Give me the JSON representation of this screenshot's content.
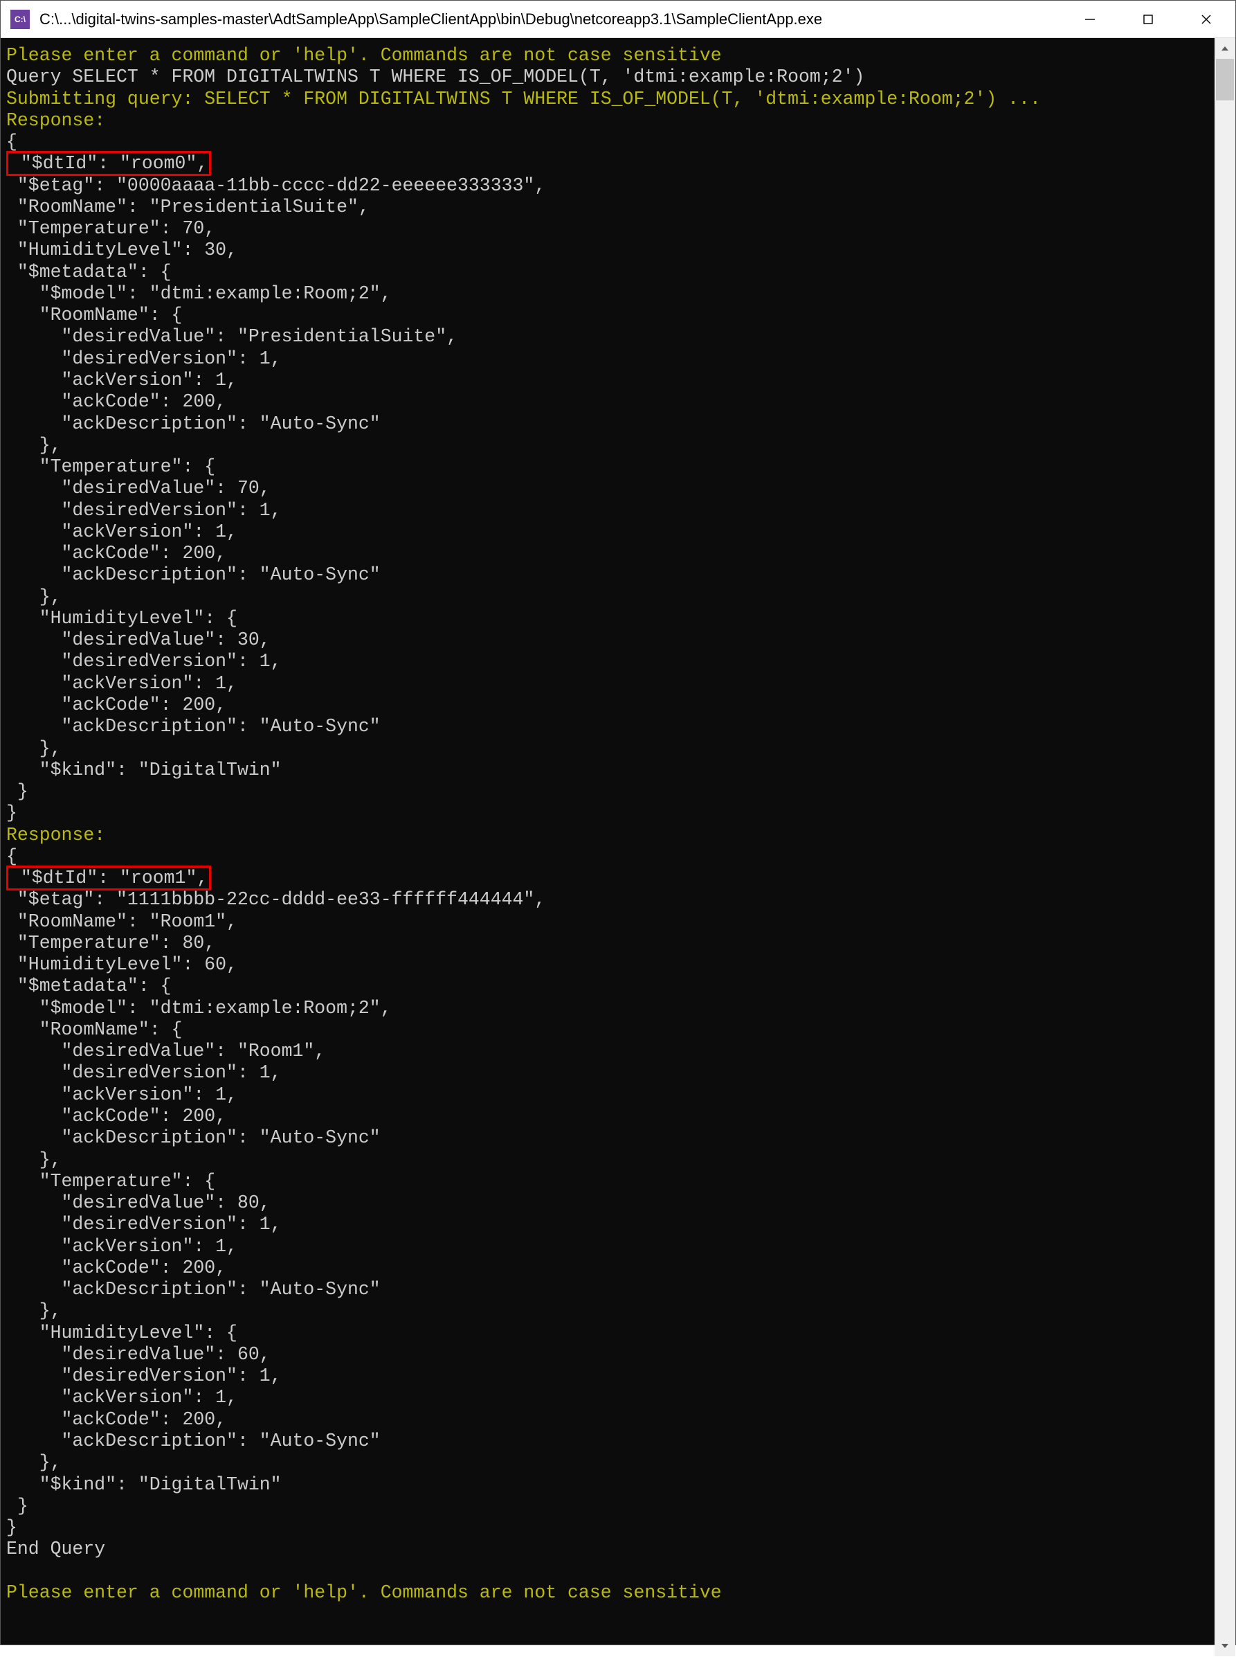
{
  "window": {
    "icon_letters": "C:\\",
    "title": "C:\\...\\digital-twins-samples-master\\AdtSampleApp\\SampleClientApp\\bin\\Debug\\netcoreapp3.1\\SampleClientApp.exe"
  },
  "console": {
    "prompt1": "Please enter a command or 'help'. Commands are not case sensitive",
    "query_line": "Query SELECT * FROM DIGITALTWINS T WHERE IS_OF_MODEL(T, 'dtmi:example:Room;2')",
    "submit_line": "Submitting query: SELECT * FROM DIGITALTWINS T WHERE IS_OF_MODEL(T, 'dtmi:example:Room;2') ...",
    "response_label": "Response:",
    "brace_open": "{",
    "brace_close": "}",
    "r0": {
      "dtid": " \"$dtId\": \"room0\",",
      "etag": " \"$etag\": \"0000aaaa-11bb-cccc-dd22-eeeeee333333\",",
      "roomname": " \"RoomName\": \"PresidentialSuite\",",
      "temp": " \"Temperature\": 70,",
      "hum": " \"HumidityLevel\": 30,",
      "meta": " \"$metadata\": {",
      "model": "   \"$model\": \"dtmi:example:Room;2\",",
      "rn_open": "   \"RoomName\": {",
      "rn_dv": "     \"desiredValue\": \"PresidentialSuite\",",
      "rn_dver": "     \"desiredVersion\": 1,",
      "rn_av": "     \"ackVersion\": 1,",
      "rn_ac": "     \"ackCode\": 200,",
      "rn_ad": "     \"ackDescription\": \"Auto-Sync\"",
      "rn_close": "   },",
      "t_open": "   \"Temperature\": {",
      "t_dv": "     \"desiredValue\": 70,",
      "t_dver": "     \"desiredVersion\": 1,",
      "t_av": "     \"ackVersion\": 1,",
      "t_ac": "     \"ackCode\": 200,",
      "t_ad": "     \"ackDescription\": \"Auto-Sync\"",
      "t_close": "   },",
      "h_open": "   \"HumidityLevel\": {",
      "h_dv": "     \"desiredValue\": 30,",
      "h_dver": "     \"desiredVersion\": 1,",
      "h_av": "     \"ackVersion\": 1,",
      "h_ac": "     \"ackCode\": 200,",
      "h_ad": "     \"ackDescription\": \"Auto-Sync\"",
      "h_close": "   },",
      "kind": "   \"$kind\": \"DigitalTwin\"",
      "meta_close": " }"
    },
    "r1": {
      "dtid": " \"$dtId\": \"room1\",",
      "etag": " \"$etag\": \"1111bbbb-22cc-dddd-ee33-ffffff444444\",",
      "roomname": " \"RoomName\": \"Room1\",",
      "temp": " \"Temperature\": 80,",
      "hum": " \"HumidityLevel\": 60,",
      "meta": " \"$metadata\": {",
      "model": "   \"$model\": \"dtmi:example:Room;2\",",
      "rn_open": "   \"RoomName\": {",
      "rn_dv": "     \"desiredValue\": \"Room1\",",
      "rn_dver": "     \"desiredVersion\": 1,",
      "rn_av": "     \"ackVersion\": 1,",
      "rn_ac": "     \"ackCode\": 200,",
      "rn_ad": "     \"ackDescription\": \"Auto-Sync\"",
      "rn_close": "   },",
      "t_open": "   \"Temperature\": {",
      "t_dv": "     \"desiredValue\": 80,",
      "t_dver": "     \"desiredVersion\": 1,",
      "t_av": "     \"ackVersion\": 1,",
      "t_ac": "     \"ackCode\": 200,",
      "t_ad": "     \"ackDescription\": \"Auto-Sync\"",
      "t_close": "   },",
      "h_open": "   \"HumidityLevel\": {",
      "h_dv": "     \"desiredValue\": 60,",
      "h_dver": "     \"desiredVersion\": 1,",
      "h_av": "     \"ackVersion\": 1,",
      "h_ac": "     \"ackCode\": 200,",
      "h_ad": "     \"ackDescription\": \"Auto-Sync\"",
      "h_close": "   },",
      "kind": "   \"$kind\": \"DigitalTwin\"",
      "meta_close": " }"
    },
    "end_query": "End Query",
    "blank": "",
    "prompt2": "Please enter a command or 'help'. Commands are not case sensitive"
  }
}
